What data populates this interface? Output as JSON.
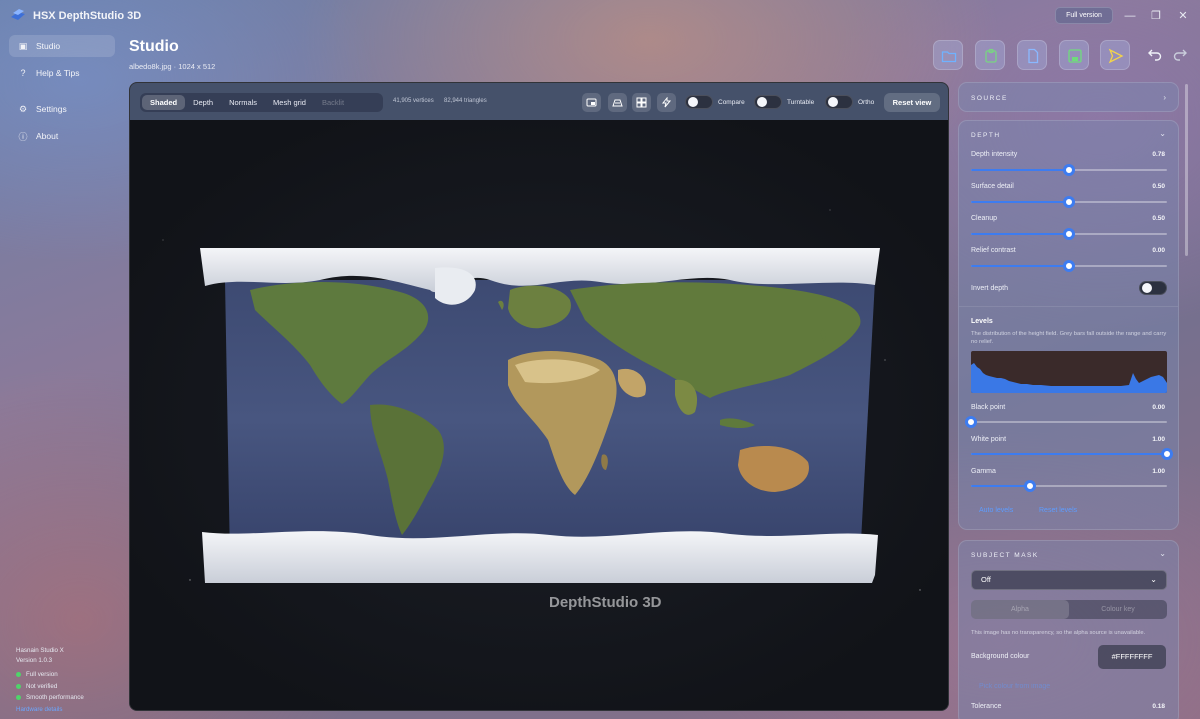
{
  "app": {
    "title": "HSX DepthStudio 3D",
    "full_version_label": "Full version"
  },
  "window_controls": {
    "minimize": "—",
    "maximize": "❐",
    "close": "✕"
  },
  "sidebar": {
    "items": [
      {
        "label": "Studio",
        "icon": "image-icon",
        "glyph": "▣",
        "active": true
      },
      {
        "label": "Help & Tips",
        "icon": "question-icon",
        "glyph": "?",
        "active": false
      },
      {
        "label": "Settings",
        "icon": "gear-icon",
        "glyph": "⚙",
        "active": false
      },
      {
        "label": "About",
        "icon": "info-icon",
        "glyph": "ⓘ",
        "active": false
      }
    ],
    "footer": {
      "company": "Hasnain Studio X",
      "version": "Version 1.0.3",
      "status": [
        "Full version",
        "Not verified",
        "Smooth performance"
      ],
      "link": "Hardware details"
    }
  },
  "header": {
    "title": "Studio",
    "file_name": "albedo8k.jpg",
    "file_dims": "1024 x 512"
  },
  "toolbar_icons": [
    {
      "icon": "folder-icon",
      "color": "#6fb2ff"
    },
    {
      "icon": "paste-icon",
      "color": "#79d483"
    },
    {
      "icon": "document-icon",
      "color": "#8ab8ff"
    },
    {
      "icon": "save-icon",
      "color": "#6fdc7c"
    },
    {
      "icon": "export-icon",
      "color": "#f2d34b"
    }
  ],
  "viewer": {
    "modes": [
      {
        "label": "Shaded",
        "active": true
      },
      {
        "label": "Depth",
        "active": false
      },
      {
        "label": "Normals",
        "active": false
      },
      {
        "label": "Mesh grid",
        "active": false
      },
      {
        "label": "Backlit",
        "active": false,
        "disabled": true
      }
    ],
    "vertices": "41,905 vertices",
    "triangles": "82,944 triangles",
    "toggles": {
      "compare": "Compare",
      "turntable": "Turntable",
      "ortho": "Ortho"
    },
    "reset_view": "Reset view",
    "watermark": "DepthStudio 3D"
  },
  "panels": {
    "source": {
      "title": "SOURCE"
    },
    "depth": {
      "title": "DEPTH",
      "sliders": [
        {
          "label": "Depth intensity",
          "value": "0.78",
          "fraction": 0.5
        },
        {
          "label": "Surface detail",
          "value": "0.50",
          "fraction": 0.5
        },
        {
          "label": "Cleanup",
          "value": "0.50",
          "fraction": 0.5
        },
        {
          "label": "Relief contrast",
          "value": "0.00",
          "fraction": 0.5
        }
      ],
      "invert_depth": "Invert depth",
      "levels": {
        "title": "Levels",
        "description": "The distribution of the height field. Grey bars fall outside the range and carry no relief.",
        "sliders": [
          {
            "label": "Black point",
            "value": "0.00",
            "fraction": 0.0
          },
          {
            "label": "White point",
            "value": "1.00",
            "fraction": 1.0
          },
          {
            "label": "Gamma",
            "value": "1.00",
            "fraction": 0.3
          }
        ],
        "auto_levels": "Auto levels",
        "reset_levels": "Reset levels"
      }
    },
    "subject_mask": {
      "title": "SUBJECT MASK",
      "mode": "Off",
      "tabs": [
        "Alpha",
        "Colour key"
      ],
      "note": "This image has no transparency, so the alpha source is unavailable.",
      "background_colour_label": "Background colour",
      "background_colour": "#FFFFFFFF",
      "pick_link": "Pick colour from image",
      "tolerance_label": "Tolerance",
      "tolerance": "0.18"
    }
  }
}
